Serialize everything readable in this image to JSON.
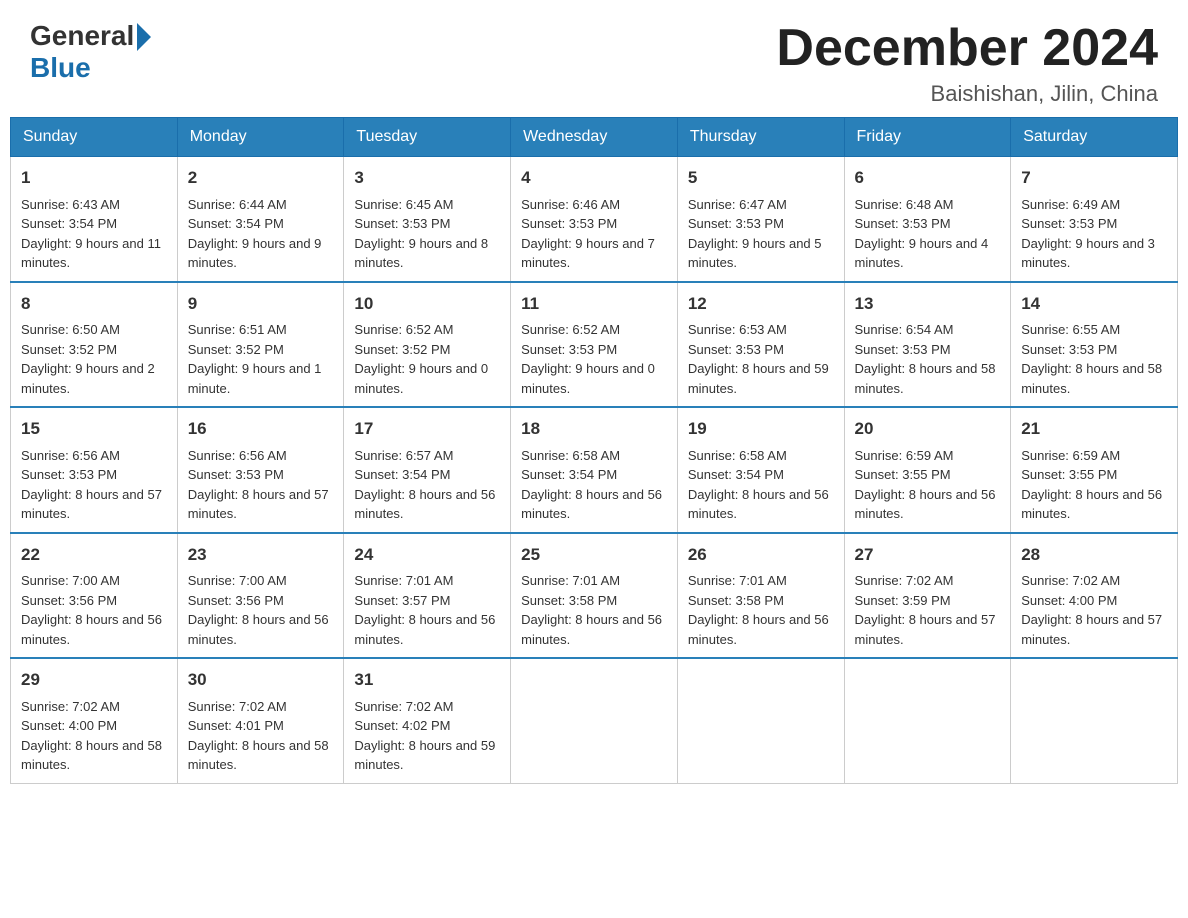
{
  "header": {
    "logo_general": "General",
    "logo_blue": "Blue",
    "month_year": "December 2024",
    "location": "Baishishan, Jilin, China"
  },
  "weekdays": [
    "Sunday",
    "Monday",
    "Tuesday",
    "Wednesday",
    "Thursday",
    "Friday",
    "Saturday"
  ],
  "weeks": [
    [
      {
        "day": "1",
        "sunrise": "6:43 AM",
        "sunset": "3:54 PM",
        "daylight": "9 hours and 11 minutes."
      },
      {
        "day": "2",
        "sunrise": "6:44 AM",
        "sunset": "3:54 PM",
        "daylight": "9 hours and 9 minutes."
      },
      {
        "day": "3",
        "sunrise": "6:45 AM",
        "sunset": "3:53 PM",
        "daylight": "9 hours and 8 minutes."
      },
      {
        "day": "4",
        "sunrise": "6:46 AM",
        "sunset": "3:53 PM",
        "daylight": "9 hours and 7 minutes."
      },
      {
        "day": "5",
        "sunrise": "6:47 AM",
        "sunset": "3:53 PM",
        "daylight": "9 hours and 5 minutes."
      },
      {
        "day": "6",
        "sunrise": "6:48 AM",
        "sunset": "3:53 PM",
        "daylight": "9 hours and 4 minutes."
      },
      {
        "day": "7",
        "sunrise": "6:49 AM",
        "sunset": "3:53 PM",
        "daylight": "9 hours and 3 minutes."
      }
    ],
    [
      {
        "day": "8",
        "sunrise": "6:50 AM",
        "sunset": "3:52 PM",
        "daylight": "9 hours and 2 minutes."
      },
      {
        "day": "9",
        "sunrise": "6:51 AM",
        "sunset": "3:52 PM",
        "daylight": "9 hours and 1 minute."
      },
      {
        "day": "10",
        "sunrise": "6:52 AM",
        "sunset": "3:52 PM",
        "daylight": "9 hours and 0 minutes."
      },
      {
        "day": "11",
        "sunrise": "6:52 AM",
        "sunset": "3:53 PM",
        "daylight": "9 hours and 0 minutes."
      },
      {
        "day": "12",
        "sunrise": "6:53 AM",
        "sunset": "3:53 PM",
        "daylight": "8 hours and 59 minutes."
      },
      {
        "day": "13",
        "sunrise": "6:54 AM",
        "sunset": "3:53 PM",
        "daylight": "8 hours and 58 minutes."
      },
      {
        "day": "14",
        "sunrise": "6:55 AM",
        "sunset": "3:53 PM",
        "daylight": "8 hours and 58 minutes."
      }
    ],
    [
      {
        "day": "15",
        "sunrise": "6:56 AM",
        "sunset": "3:53 PM",
        "daylight": "8 hours and 57 minutes."
      },
      {
        "day": "16",
        "sunrise": "6:56 AM",
        "sunset": "3:53 PM",
        "daylight": "8 hours and 57 minutes."
      },
      {
        "day": "17",
        "sunrise": "6:57 AM",
        "sunset": "3:54 PM",
        "daylight": "8 hours and 56 minutes."
      },
      {
        "day": "18",
        "sunrise": "6:58 AM",
        "sunset": "3:54 PM",
        "daylight": "8 hours and 56 minutes."
      },
      {
        "day": "19",
        "sunrise": "6:58 AM",
        "sunset": "3:54 PM",
        "daylight": "8 hours and 56 minutes."
      },
      {
        "day": "20",
        "sunrise": "6:59 AM",
        "sunset": "3:55 PM",
        "daylight": "8 hours and 56 minutes."
      },
      {
        "day": "21",
        "sunrise": "6:59 AM",
        "sunset": "3:55 PM",
        "daylight": "8 hours and 56 minutes."
      }
    ],
    [
      {
        "day": "22",
        "sunrise": "7:00 AM",
        "sunset": "3:56 PM",
        "daylight": "8 hours and 56 minutes."
      },
      {
        "day": "23",
        "sunrise": "7:00 AM",
        "sunset": "3:56 PM",
        "daylight": "8 hours and 56 minutes."
      },
      {
        "day": "24",
        "sunrise": "7:01 AM",
        "sunset": "3:57 PM",
        "daylight": "8 hours and 56 minutes."
      },
      {
        "day": "25",
        "sunrise": "7:01 AM",
        "sunset": "3:58 PM",
        "daylight": "8 hours and 56 minutes."
      },
      {
        "day": "26",
        "sunrise": "7:01 AM",
        "sunset": "3:58 PM",
        "daylight": "8 hours and 56 minutes."
      },
      {
        "day": "27",
        "sunrise": "7:02 AM",
        "sunset": "3:59 PM",
        "daylight": "8 hours and 57 minutes."
      },
      {
        "day": "28",
        "sunrise": "7:02 AM",
        "sunset": "4:00 PM",
        "daylight": "8 hours and 57 minutes."
      }
    ],
    [
      {
        "day": "29",
        "sunrise": "7:02 AM",
        "sunset": "4:00 PM",
        "daylight": "8 hours and 58 minutes."
      },
      {
        "day": "30",
        "sunrise": "7:02 AM",
        "sunset": "4:01 PM",
        "daylight": "8 hours and 58 minutes."
      },
      {
        "day": "31",
        "sunrise": "7:02 AM",
        "sunset": "4:02 PM",
        "daylight": "8 hours and 59 minutes."
      },
      null,
      null,
      null,
      null
    ]
  ],
  "labels": {
    "sunrise": "Sunrise: ",
    "sunset": "Sunset: ",
    "daylight": "Daylight: "
  }
}
